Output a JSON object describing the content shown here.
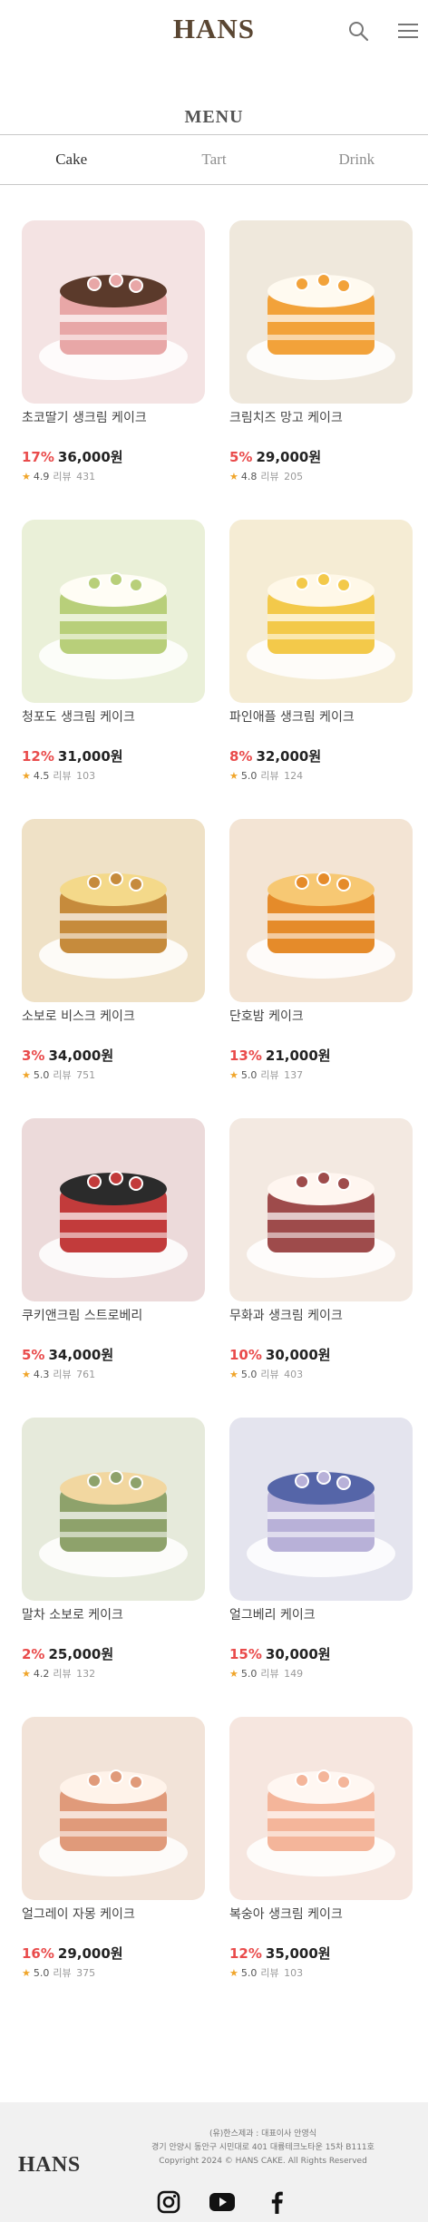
{
  "header": {
    "logo": "HANS",
    "search_icon": "search-icon",
    "menu_icon": "hamburger-menu-icon"
  },
  "page": {
    "title": "MENU"
  },
  "tabs": [
    {
      "label": "Cake",
      "active": true
    },
    {
      "label": "Tart",
      "active": false
    },
    {
      "label": "Drink",
      "active": false
    }
  ],
  "products": [
    {
      "name": "초코딸기 생크림 케이크",
      "discount": "17%",
      "price": "36,000원",
      "rating": "4.9",
      "review_label": "리뷰",
      "review_count": "431"
    },
    {
      "name": "크림치즈 망고 케이크",
      "discount": "5%",
      "price": "29,000원",
      "rating": "4.8",
      "review_label": "리뷰",
      "review_count": "205"
    },
    {
      "name": "청포도 생크림 케이크",
      "discount": "12%",
      "price": "31,000원",
      "rating": "4.5",
      "review_label": "리뷰",
      "review_count": "103"
    },
    {
      "name": "파인애플 생크림 케이크",
      "discount": "8%",
      "price": "32,000원",
      "rating": "5.0",
      "review_label": "리뷰",
      "review_count": "124"
    },
    {
      "name": "소보로 비스크 케이크",
      "discount": "3%",
      "price": "34,000원",
      "rating": "5.0",
      "review_label": "리뷰",
      "review_count": "751"
    },
    {
      "name": "단호밤 케이크",
      "discount": "13%",
      "price": "21,000원",
      "rating": "5.0",
      "review_label": "리뷰",
      "review_count": "137"
    },
    {
      "name": "쿠키앤크림 스트로베리",
      "discount": "5%",
      "price": "34,000원",
      "rating": "4.3",
      "review_label": "리뷰",
      "review_count": "761"
    },
    {
      "name": "무화과 생크림 케이크",
      "discount": "10%",
      "price": "30,000원",
      "rating": "5.0",
      "review_label": "리뷰",
      "review_count": "403"
    },
    {
      "name": "말차 소보로 케이크",
      "discount": "2%",
      "price": "25,000원",
      "rating": "4.2",
      "review_label": "리뷰",
      "review_count": "132"
    },
    {
      "name": "얼그베리 케이크",
      "discount": "15%",
      "price": "30,000원",
      "rating": "5.0",
      "review_label": "리뷰",
      "review_count": "149"
    },
    {
      "name": "얼그레이 자몽 케이크",
      "discount": "16%",
      "price": "29,000원",
      "rating": "5.0",
      "review_label": "리뷰",
      "review_count": "375"
    },
    {
      "name": "복숭아 생크림 케이크",
      "discount": "12%",
      "price": "35,000원",
      "rating": "5.0",
      "review_label": "리뷰",
      "review_count": "103"
    }
  ],
  "footer": {
    "logo": "HANS",
    "company": "(유)한스제과 : 대표이사 안영식",
    "address": "경기 안양시 동안구 시민대로 401 대륭테크노타운 15차 B111호",
    "copyright": "Copyright 2024 © HANS CAKE. All Rights Reserved",
    "socials": [
      "instagram-icon",
      "youtube-icon",
      "facebook-icon"
    ]
  },
  "colors": {
    "brand": "#5a4632",
    "discount": "#e94b4b",
    "star": "#f0a52a",
    "footer_bg": "#f1f1f1"
  }
}
